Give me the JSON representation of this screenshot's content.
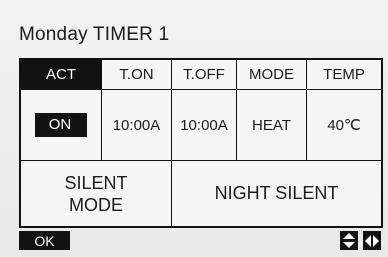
{
  "header": {
    "title": "Monday TIMER 1"
  },
  "table": {
    "headers": [
      "ACT",
      "T.ON",
      "T.OFF",
      "MODE",
      "TEMP"
    ],
    "row": {
      "act": "ON",
      "t_on": "10:00A",
      "t_off": "10:00A",
      "mode": "HEAT",
      "temp": "40℃"
    },
    "silent_mode_line1": "SILENT",
    "silent_mode_line2": "MODE",
    "night_silent": "NIGHT SILENT"
  },
  "footer": {
    "ok_label": "OK",
    "updown_icon": "up-down-arrows-icon",
    "leftright_icon": "left-right-arrows-icon"
  },
  "colors": {
    "background": "#eeeeee",
    "foreground": "#121212",
    "inverse_text": "#ffffff"
  }
}
